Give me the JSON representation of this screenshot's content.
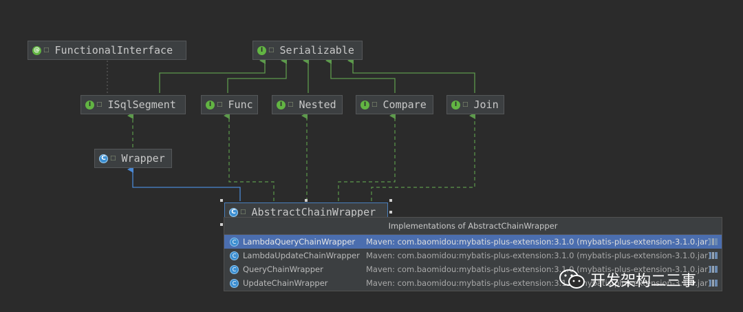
{
  "diagram": {
    "nodes": [
      {
        "id": "functional",
        "label": "FunctionalInterface",
        "kind": "a"
      },
      {
        "id": "serializable",
        "label": "Serializable",
        "kind": "i"
      },
      {
        "id": "isqlsegment",
        "label": "ISqlSegment",
        "kind": "i"
      },
      {
        "id": "func",
        "label": "Func",
        "kind": "i"
      },
      {
        "id": "nested",
        "label": "Nested",
        "kind": "i"
      },
      {
        "id": "compare",
        "label": "Compare",
        "kind": "i"
      },
      {
        "id": "join",
        "label": "Join",
        "kind": "i"
      },
      {
        "id": "wrapper",
        "label": "Wrapper",
        "kind": "c"
      },
      {
        "id": "abstractchain",
        "label": "AbstractChainWrapper",
        "kind": "c"
      }
    ],
    "badges": {
      "i": "I",
      "c": "C",
      "a": "@"
    }
  },
  "popup": {
    "title": "Implementations of AbstractChainWrapper",
    "rows": [
      {
        "name": "LambdaQueryChainWrapper",
        "location": "Maven: com.baomidou:mybatis-plus-extension:3.1.0 (mybatis-plus-extension-3.1.0.jar)"
      },
      {
        "name": "LambdaUpdateChainWrapper",
        "location": "Maven: com.baomidou:mybatis-plus-extension:3.1.0 (mybatis-plus-extension-3.1.0.jar)"
      },
      {
        "name": "QueryChainWrapper",
        "location": "Maven: com.baomidou:mybatis-plus-extension:3.1.0 (mybatis-plus-extension-3.1.0.jar)"
      },
      {
        "name": "UpdateChainWrapper",
        "location": "Maven: com.baomidou:mybatis-plus-extension:3.1.0 (mybatis-plus-extension-3.1.0.jar)"
      }
    ],
    "selected_index": 0
  },
  "watermark": {
    "text": "开发架构二三事"
  },
  "colors": {
    "green_edge": "#5d9a4c",
    "blue_edge": "#4a88d4",
    "dotted_edge": "#6a6a6a",
    "selection": "#4b6eaf"
  }
}
